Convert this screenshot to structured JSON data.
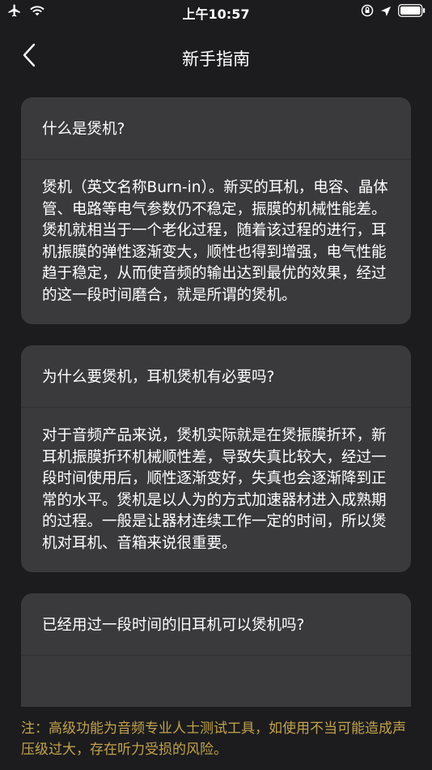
{
  "status_bar": {
    "time": "上午10:57",
    "icons": [
      "airplane-icon",
      "wifi-icon",
      "orientation-lock-icon",
      "location-icon",
      "battery-icon"
    ]
  },
  "nav": {
    "back_icon": "chevron-left-icon",
    "title": "新手指南"
  },
  "faq": [
    {
      "question": "什么是煲机?",
      "answer": "煲机（英文名称Burn-in）。新买的耳机，电容、晶体管、电路等电气参数仍不稳定，振膜的机械性能差。煲机就相当于一个老化过程，随着该过程的进行，耳机振膜的弹性逐渐变大，顺性也得到增强，电气性能趋于稳定，从而使音频的输出达到最优的效果，经过的这一段时间磨合，就是所谓的煲机。"
    },
    {
      "question": "为什么要煲机，耳机煲机有必要吗?",
      "answer": "对于音频产品来说，煲机实际就是在煲振膜折环，新耳机振膜折环机械顺性差，导致失真比较大，经过一段时间使用后，顺性逐渐变好，失真也会逐渐降到正常的水平。煲机是以人为的方式加速器材进入成熟期的过程。一般是让器材连续工作一定的时间，所以煲机对耳机、音箱来说很重要。"
    },
    {
      "question": "已经用过一段时间的旧耳机可以煲机吗?",
      "answer": ""
    }
  ],
  "notice": "注：高级功能为音频专业人士测试工具，如使用不当可能造成声压级过大，存在听力受损的风险。",
  "colors": {
    "background": "#1c1c1e",
    "card": "#3a3a3c",
    "notice_text": "#c2a24d"
  }
}
